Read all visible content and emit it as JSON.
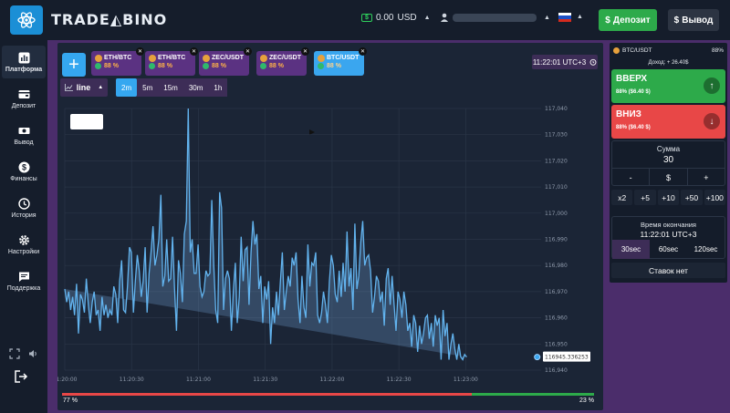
{
  "header": {
    "logo_text": "TRADE◭BINO",
    "balance_value": "0.00",
    "balance_currency": "USD",
    "deposit_label": "Депозит",
    "withdraw_label": "Вывод",
    "icons": {
      "logo": "atom-logo-icon",
      "balance": "cash-icon",
      "user": "user-icon",
      "flag": "russian-flag-icon"
    }
  },
  "sidebar": {
    "items": [
      {
        "label": "Платформа",
        "icon": "chart-icon",
        "active": true
      },
      {
        "label": "Депозит",
        "icon": "wallet-icon",
        "active": false
      },
      {
        "label": "Вывод",
        "icon": "cash-out-icon",
        "active": false
      },
      {
        "label": "Финансы",
        "icon": "dollar-icon",
        "active": false
      },
      {
        "label": "История",
        "icon": "clock-icon",
        "active": false
      },
      {
        "label": "Настройки",
        "icon": "gear-icon",
        "active": false
      },
      {
        "label": "Поддержка",
        "icon": "chat-icon",
        "active": false
      }
    ]
  },
  "assets": [
    {
      "name": "ETH/BTC",
      "pct": "88 %",
      "active": false
    },
    {
      "name": "ETH/BTC",
      "pct": "88 %",
      "active": false
    },
    {
      "name": "ZEC/USDT",
      "pct": "88 %",
      "active": false
    },
    {
      "name": "ZEC/USDT",
      "pct": "88 %",
      "active": false
    },
    {
      "name": "BTC/USDT",
      "pct": "88 %",
      "active": true
    }
  ],
  "clock": "11:22:01 UTC+3",
  "toolbar": {
    "chart_type": "line",
    "timeframes": [
      "2m",
      "5m",
      "15m",
      "30m",
      "1h"
    ],
    "active_timeframe": "2m"
  },
  "chart_data": {
    "type": "area",
    "title": "",
    "xlabel": "",
    "ylabel": "",
    "ylim": [
      116940,
      117040
    ],
    "yticks": [
      "117,040",
      "117,030",
      "117,020",
      "117,010",
      "117,000",
      "116,990",
      "116,980",
      "116,970",
      "116,960",
      "116,950",
      "116,940"
    ],
    "xticks": [
      "11:20:00",
      "11:20:30",
      "11:21:00",
      "11:21:30",
      "11:22:00",
      "11:22:30",
      "11:23:00"
    ],
    "current_price": "116945.336253",
    "series": [
      {
        "x_seconds_from_1120": [
          0,
          1,
          2,
          3,
          4,
          5,
          6,
          7,
          8,
          9,
          10,
          11,
          12,
          13,
          14,
          15,
          16,
          17,
          18,
          19,
          20,
          21,
          22,
          23,
          24,
          25,
          26,
          27,
          28,
          29,
          30,
          31,
          32,
          33,
          34,
          35,
          36,
          37,
          38,
          39,
          40,
          41,
          42,
          43,
          44,
          45,
          46,
          47,
          48,
          49,
          50,
          51,
          52,
          53,
          54,
          55,
          56,
          57,
          58,
          59,
          60,
          61,
          62,
          63,
          64,
          65,
          66,
          67,
          68,
          69,
          70,
          71,
          72,
          73,
          74,
          75,
          76,
          77,
          78,
          79,
          80,
          81,
          82,
          83,
          84,
          85,
          86,
          87,
          88,
          89,
          90,
          91,
          92,
          93,
          94,
          95,
          96,
          97,
          98,
          99,
          100,
          101,
          102,
          103,
          104,
          105,
          106,
          107,
          108,
          109,
          110,
          111,
          112,
          113,
          114,
          115,
          116,
          117,
          118,
          119,
          120,
          121,
          122,
          123,
          124,
          125,
          126,
          127,
          128,
          129,
          130,
          131,
          132,
          133,
          134,
          135,
          136,
          137,
          138,
          139,
          140,
          141,
          142,
          143,
          144,
          145,
          146,
          147,
          148,
          149,
          150,
          151,
          152,
          153,
          154,
          155,
          156,
          157,
          158,
          159,
          160,
          161,
          162,
          163,
          164,
          165,
          166,
          167,
          168,
          169,
          170,
          171,
          172,
          173,
          174,
          175,
          176,
          177,
          178,
          179,
          180,
          181,
          182,
          183,
          184,
          185,
          186,
          187,
          188,
          189,
          190,
          191,
          192,
          193,
          194,
          195,
          196,
          197,
          198,
          199,
          200,
          201,
          202,
          203,
          204,
          205,
          206,
          207,
          208,
          209,
          210,
          211,
          212,
          213,
          214,
          215,
          216,
          217,
          218,
          219,
          220,
          221,
          222,
          223,
          224,
          225,
          226,
          227,
          228,
          229,
          230,
          231,
          232,
          233,
          234,
          235,
          236,
          237,
          238,
          239,
          240,
          241
        ],
        "values": [
          116971,
          116966,
          116970,
          116963,
          116968,
          116961,
          116973,
          116954,
          116969,
          116967,
          116962,
          116975,
          116965,
          116958,
          116966,
          116970,
          116961,
          116963,
          116955,
          116968,
          116961,
          116965,
          116960,
          116963,
          116961,
          116972,
          116969,
          116958,
          116974,
          116982,
          116963,
          116962,
          116972,
          116987,
          116985,
          116962,
          116974,
          116984,
          116978,
          116968,
          116974,
          116987,
          116962,
          116977,
          116985,
          116995,
          116980,
          116984,
          116990,
          117007,
          116972,
          116976,
          116990,
          116974,
          116975,
          116991,
          116971,
          116955,
          116982,
          116977,
          116966,
          116992,
          116997,
          117040,
          116985,
          116990,
          116977,
          116977,
          116988,
          116972,
          116968,
          116970,
          116978,
          116976,
          116977,
          117005,
          116980,
          116963,
          116958,
          117008,
          117002,
          116963,
          116975,
          116978,
          116975,
          116955,
          116970,
          116981,
          116958,
          116968,
          116991,
          116974,
          116986,
          116987,
          116965,
          116985,
          116997,
          116988,
          116992,
          116971,
          116976,
          116958,
          116972,
          116967,
          116974,
          116950,
          116964,
          116958,
          116970,
          116961,
          116974,
          116985,
          116963,
          116970,
          116976,
          116972,
          116983,
          116980,
          116985,
          116967,
          116958,
          116976,
          116964,
          116960,
          116988,
          116972,
          116981,
          116980,
          116985,
          116961,
          116958,
          116962,
          116970,
          116965,
          116958,
          116974,
          116984,
          116980,
          116969,
          116966,
          116978,
          116968,
          116981,
          116970,
          116993,
          116972,
          116979,
          116963,
          116996,
          116971,
          116976,
          116989,
          116997,
          116980,
          116983,
          116984,
          116978,
          116962,
          116968,
          116976,
          116974,
          116966,
          116970,
          116957,
          116975,
          116979,
          116965,
          116976,
          116965,
          116955,
          116970,
          116967,
          116960,
          116970,
          116965,
          116955,
          116958,
          116949,
          116961,
          116958,
          116947,
          116957,
          116950,
          116954,
          116960,
          116961,
          116952,
          116958,
          116949,
          116961,
          116957,
          116960,
          116944,
          116963,
          116953,
          116958,
          116944,
          116950,
          116954,
          116948,
          116944,
          116950,
          116945,
          116944,
          116946,
          116945
        ]
      }
    ]
  },
  "bottom": {
    "left_pct": "77 %",
    "right_pct": "23 %",
    "left_fraction": 0.77
  },
  "panel": {
    "asset": "BTC/USDT",
    "asset_pct": "88%",
    "income": "Доход: + 26.40$",
    "up_label": "ВВЕРХ",
    "up_sub": "88% ($6.40 $)",
    "down_label": "ВНИЗ",
    "down_sub": "88% ($6.40 $)",
    "sum_label": "Сумма",
    "sum_value": "30",
    "sum_minus": "-",
    "sum_currency": "$",
    "sum_plus": "+",
    "multipliers": [
      "x2",
      "+5",
      "+10",
      "+50",
      "+100"
    ],
    "expiry_label": "Время окончания",
    "expiry_value": "11:22:01 UTC+3",
    "expiry_tabs": [
      "30sec",
      "60sec",
      "120sec"
    ],
    "active_expiry": "30sec",
    "no_bets": "Ставок нет"
  }
}
